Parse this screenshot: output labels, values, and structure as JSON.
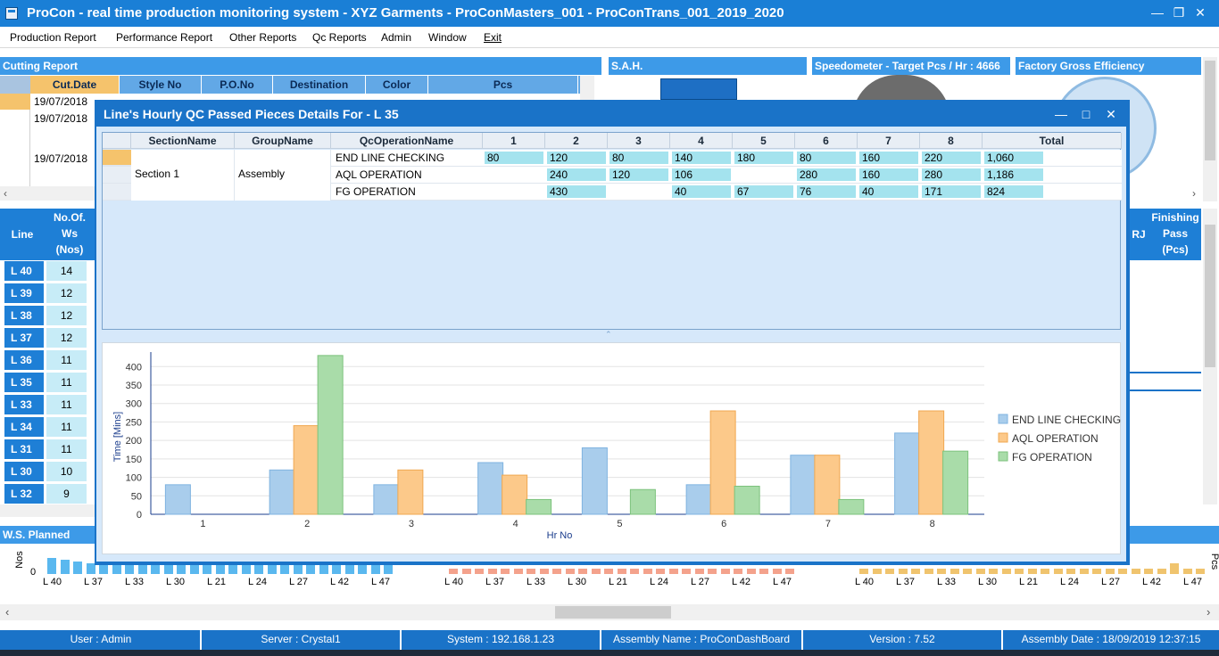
{
  "window": {
    "title": "ProCon - real time production monitoring system - XYZ Garments - ProConMasters_001 - ProConTrans_001_2019_2020",
    "minimize": "—",
    "maximize": "❐",
    "close": "✕"
  },
  "menu": [
    "Production Report",
    "Performance Report",
    "Other Reports",
    "Qc Reports",
    "Admin",
    "Window",
    "Exit"
  ],
  "panels": {
    "cutting": {
      "title": "Cutting Report",
      "columns": [
        "Cut.Date",
        "Style No",
        "P.O.No",
        "Destination",
        "Color",
        "Pcs"
      ],
      "dates": [
        "19/07/2018",
        "19/07/2018",
        "19/07/2018"
      ]
    },
    "sah": {
      "title": "S.A.H."
    },
    "speedo": {
      "title": "Speedometer - Target Pcs / Hr : 4666"
    },
    "efficiency": {
      "title": "Factory Gross Efficiency"
    },
    "lines": {
      "header_line": "Line",
      "header_ws": [
        "No.Of.",
        "Ws",
        "(Nos)"
      ],
      "rows": [
        {
          "line": "L 40",
          "ws": "14"
        },
        {
          "line": "L 39",
          "ws": "12"
        },
        {
          "line": "L 38",
          "ws": "12"
        },
        {
          "line": "L 37",
          "ws": "12"
        },
        {
          "line": "L 36",
          "ws": "11"
        },
        {
          "line": "L 35",
          "ws": "11"
        },
        {
          "line": "L 33",
          "ws": "11"
        },
        {
          "line": "L 34",
          "ws": "11"
        },
        {
          "line": "L 31",
          "ws": "11"
        },
        {
          "line": "L 30",
          "ws": "10"
        },
        {
          "line": "L 32",
          "ws": "9"
        }
      ]
    },
    "finishing": {
      "title": "Finishing",
      "sub": [
        "Pass",
        "(Pcs)"
      ],
      "rj": "RJ"
    },
    "ws_planned": {
      "title": "W.S. Planned",
      "ylabel": "Nos",
      "zero": "0",
      "xlabels": [
        "L 40",
        "L 37",
        "L 33",
        "L 30",
        "L 21",
        "L 24",
        "L 27",
        "L 42",
        "L 47"
      ]
    },
    "mini_right_ylabel": "Pcs"
  },
  "modal": {
    "title": "Line's Hourly QC Passed Pieces Details For - L 35",
    "columns": [
      "SectionName",
      "GroupName",
      "QcOperationName",
      "1",
      "2",
      "3",
      "4",
      "5",
      "6",
      "7",
      "8",
      "Total"
    ],
    "section": "Section 1",
    "group": "Assembly",
    "rows": [
      {
        "op": "END LINE CHECKING",
        "vals": [
          "80",
          "120",
          "80",
          "140",
          "180",
          "80",
          "160",
          "220",
          "1,060"
        ]
      },
      {
        "op": "AQL OPERATION",
        "vals": [
          "",
          "240",
          "120",
          "106",
          "",
          "280",
          "160",
          "280",
          "1,186"
        ]
      },
      {
        "op": "FG OPERATION",
        "vals": [
          "",
          "430",
          "",
          "40",
          "67",
          "76",
          "40",
          "171",
          "824"
        ]
      }
    ]
  },
  "chart_data": {
    "type": "bar",
    "title": "",
    "xlabel": "Hr No",
    "ylabel": "Time [Mins]",
    "ylim": [
      0,
      420
    ],
    "yticks": [
      0,
      50,
      100,
      150,
      200,
      250,
      300,
      350,
      400
    ],
    "categories": [
      "1",
      "2",
      "3",
      "4",
      "5",
      "6",
      "7",
      "8"
    ],
    "series": [
      {
        "name": "END LINE CHECKING",
        "color": "#a9cdec",
        "stroke": "#7fb3e0",
        "values": [
          80,
          120,
          80,
          140,
          180,
          80,
          160,
          220
        ]
      },
      {
        "name": "AQL OPERATION",
        "color": "#fcc98a",
        "stroke": "#f0a850",
        "values": [
          0,
          240,
          120,
          106,
          0,
          280,
          160,
          280
        ]
      },
      {
        "name": "FG OPERATION",
        "color": "#a9dca9",
        "stroke": "#7cc27c",
        "values": [
          0,
          430,
          0,
          40,
          67,
          76,
          40,
          171
        ]
      }
    ],
    "grid": true,
    "legend": "right"
  },
  "status": {
    "user": "User : Admin",
    "server": "Server : Crystal1",
    "system": "System : 192.168.1.23",
    "assembly": "Assembly Name : ProConDashBoard",
    "version": "Version : 7.52",
    "date": "Assembly Date : 18/09/2019 12:37:15"
  }
}
